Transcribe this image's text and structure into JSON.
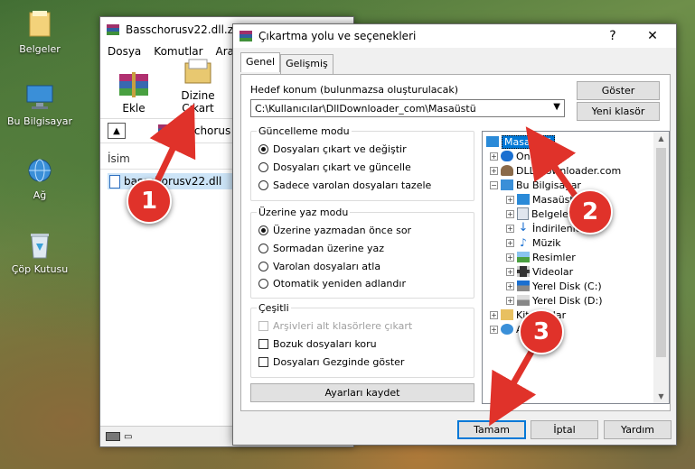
{
  "desktop": {
    "icons": [
      {
        "label": "Belgeler"
      },
      {
        "label": "Bu Bilgisayar"
      },
      {
        "label": "Ağ"
      },
      {
        "label": "Çöp Kutusu"
      }
    ]
  },
  "winrar": {
    "title": "Basschorusv22.dll.zi",
    "menu": [
      "Dosya",
      "Komutlar",
      "Araçla"
    ],
    "tools": {
      "add": "Ekle",
      "extract_to": "Dizine Çıkart"
    },
    "address": "asschorus",
    "column_name": "İsim",
    "file_name": "basschorusv22.dll"
  },
  "dialog": {
    "title": "Çıkartma yolu ve seçenekleri",
    "help_glyph": "?",
    "close_glyph": "✕",
    "tabs": [
      "Genel",
      "Gelişmiş"
    ],
    "dest_label": "Hedef konum (bulunmazsa oluşturulacak)",
    "dest_value": "C:\\Kullanıcılar\\DllDownloader_com\\Masaüstü",
    "show_button": "Göster",
    "new_folder_button": "Yeni klasör",
    "update_mode": {
      "title": "Güncelleme modu",
      "options": [
        "Dosyaları çıkart ve değiştir",
        "Dosyaları çıkart ve güncelle",
        "Sadece varolan dosyaları tazele"
      ],
      "selected": 0
    },
    "overwrite_mode": {
      "title": "Üzerine yaz modu",
      "options": [
        "Üzerine yazmadan önce sor",
        "Sormadan üzerine yaz",
        "Varolan dosyaları atla",
        "Otomatik yeniden adlandır"
      ],
      "selected": 0
    },
    "misc": {
      "title": "Çeşitli",
      "options": [
        "Arşivleri alt klasörlere çıkart",
        "Bozuk dosyaları koru",
        "Dosyaları Gezginde göster"
      ]
    },
    "save_settings": "Ayarları kaydet",
    "tree": [
      {
        "label": "Masaüstü",
        "selected": true
      },
      {
        "label": "OneDrive"
      },
      {
        "label": "DLL Downloader.com"
      },
      {
        "label": "Bu Bilgisayar"
      },
      {
        "label": "Masaüstü"
      },
      {
        "label": "Belgeler"
      },
      {
        "label": "İndirilenler"
      },
      {
        "label": "Müzik"
      },
      {
        "label": "Resimler"
      },
      {
        "label": "Videolar"
      },
      {
        "label": "Yerel Disk (C:)"
      },
      {
        "label": "Yerel Disk (D:)"
      },
      {
        "label": "Kitaplıklar"
      },
      {
        "label": "Ağ"
      }
    ],
    "buttons": {
      "ok": "Tamam",
      "cancel": "İptal",
      "help": "Yardım"
    }
  },
  "callouts": [
    "1",
    "2",
    "3"
  ],
  "colors": {
    "accent": "#0078d7",
    "callout": "#e0322a"
  }
}
